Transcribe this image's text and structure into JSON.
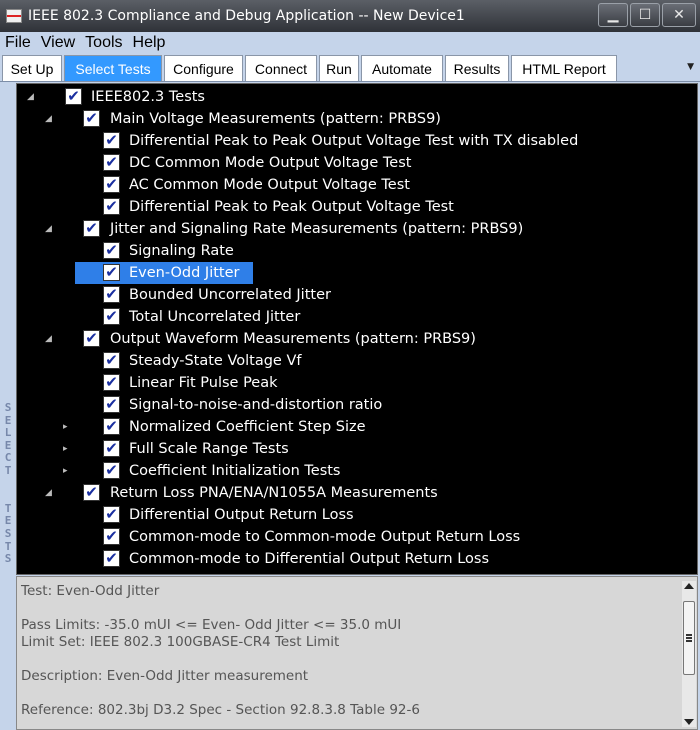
{
  "window": {
    "title": "IEEE 802.3 Compliance and Debug Application -- New Device1",
    "minimize": "▁",
    "maximize": "☐",
    "close": "✕"
  },
  "menu": [
    "File",
    "View",
    "Tools",
    "Help"
  ],
  "tabs": [
    {
      "label": "Set Up",
      "active": false
    },
    {
      "label": "Select Tests",
      "active": true
    },
    {
      "label": "Configure",
      "active": false
    },
    {
      "label": "Connect",
      "active": false
    },
    {
      "label": "Run",
      "active": false
    },
    {
      "label": "Automate",
      "active": false
    },
    {
      "label": "Results",
      "active": false
    },
    {
      "label": "HTML Report",
      "active": false
    }
  ],
  "side_label": "SELECT  TESTS",
  "tree": [
    {
      "label": "IEEE802.3 Tests",
      "level": 0,
      "expander": "◢",
      "checked": true
    },
    {
      "label": "Main Voltage Measurements (pattern: PRBS9)",
      "level": 1,
      "expander": "◢",
      "checked": true
    },
    {
      "label": "Differential Peak to Peak Output Voltage Test with TX disabled",
      "level": 2,
      "expander": "",
      "checked": true
    },
    {
      "label": "DC Common Mode Output Voltage Test",
      "level": 2,
      "expander": "",
      "checked": true
    },
    {
      "label": "AC Common Mode Output Voltage Test",
      "level": 2,
      "expander": "",
      "checked": true
    },
    {
      "label": "Differential Peak to Peak Output Voltage Test",
      "level": 2,
      "expander": "",
      "checked": true
    },
    {
      "label": "Jitter and Signaling Rate Measurements (pattern: PRBS9)",
      "level": 1,
      "expander": "◢",
      "checked": true
    },
    {
      "label": "Signaling Rate",
      "level": 2,
      "expander": "",
      "checked": true
    },
    {
      "label": "Even-Odd Jitter",
      "level": 2,
      "expander": "",
      "checked": true,
      "selected": true
    },
    {
      "label": "Bounded Uncorrelated Jitter",
      "level": 2,
      "expander": "",
      "checked": true
    },
    {
      "label": "Total Uncorrelated Jitter",
      "level": 2,
      "expander": "",
      "checked": true
    },
    {
      "label": "Output Waveform Measurements (pattern: PRBS9)",
      "level": 1,
      "expander": "◢",
      "checked": true
    },
    {
      "label": "Steady-State Voltage Vf",
      "level": 2,
      "expander": "",
      "checked": true
    },
    {
      "label": "Linear Fit Pulse Peak",
      "level": 2,
      "expander": "",
      "checked": true
    },
    {
      "label": "Signal-to-noise-and-distortion ratio",
      "level": 2,
      "expander": "",
      "checked": true
    },
    {
      "label": "Normalized Coefficient Step Size",
      "level": 2,
      "expander": "▸",
      "checked": true
    },
    {
      "label": "Full Scale Range Tests",
      "level": 2,
      "expander": "▸",
      "checked": true
    },
    {
      "label": "Coefficient Initialization Tests",
      "level": 2,
      "expander": "▸",
      "checked": true
    },
    {
      "label": "Return Loss PNA/ENA/N1055A Measurements",
      "level": 1,
      "expander": "◢",
      "checked": true
    },
    {
      "label": "Differential Output Return Loss",
      "level": 2,
      "expander": "",
      "checked": true
    },
    {
      "label": "Common-mode to Common-mode Output Return Loss",
      "level": 2,
      "expander": "",
      "checked": true
    },
    {
      "label": "Common-mode to Differential Output Return Loss",
      "level": 2,
      "expander": "",
      "checked": true
    }
  ],
  "check_glyph": "✔",
  "description": {
    "test": "Test: Even-Odd Jitter",
    "pass_limits": "Pass Limits: -35.0 mUI <= Even- Odd Jitter <= 35.0 mUI",
    "limit_set": "Limit Set: IEEE 802.3 100GBASE-CR4 Test Limit",
    "description": "Description: Even-Odd Jitter measurement",
    "reference": "Reference: 802.3bj D3.2 Spec - Section 92.8.3.8 Table 92-6"
  }
}
